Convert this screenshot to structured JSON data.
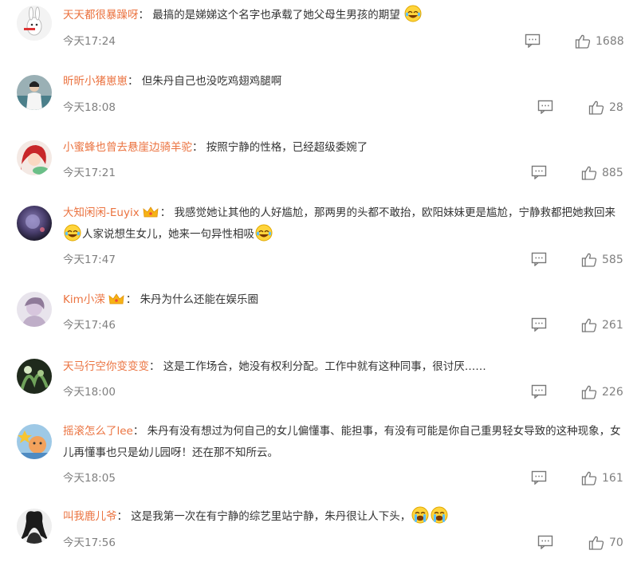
{
  "comments": [
    {
      "user": "天天都很暴躁呀",
      "sep": "：",
      "parts": [
        "最搞的是娣娣这个名字也承载了她父母生男孩的期望"
      ],
      "time": "今天17:24",
      "likes": "1688"
    },
    {
      "user": "昕昕小猪崽崽",
      "sep": "：",
      "parts": [
        "但朱丹自己也没吃鸡翅鸡腿啊"
      ],
      "time": "今天18:08",
      "likes": "28"
    },
    {
      "user": "小蜜蜂也曾去悬崖边骑羊驼",
      "sep": "：",
      "parts": [
        "按照宁静的性格，已经超级委婉了"
      ],
      "time": "今天17:21",
      "likes": "885"
    },
    {
      "user": "大知闲闲-Euyix",
      "sep": "：",
      "parts": [
        "我感觉她让其他的人好尴尬，那两男的头都不敢抬，欧阳妹妹更是尴尬，宁静救都把她救回来",
        "人家说想生女儿，她来一句异性相吸"
      ],
      "time": "今天17:47",
      "likes": "585"
    },
    {
      "user": "Kim小溁",
      "sep": "：",
      "parts": [
        "朱丹为什么还能在娱乐圈"
      ],
      "time": "今天17:46",
      "likes": "261"
    },
    {
      "user": "天马行空你变变变",
      "sep": "：",
      "parts": [
        "这是工作场合，她没有权利分配。工作中就有这种同事，很讨厌……"
      ],
      "time": "今天18:00",
      "likes": "226"
    },
    {
      "user": "摇滚怎么了lee",
      "sep": "：",
      "parts": [
        "朱丹有没有想过为何自己的女儿偏懂事、能担事，有没有可能是你自己重男轻女导致的这种现象，女儿再懂事也只是幼儿园呀！还在那不知所云。"
      ],
      "time": "今天18:05",
      "likes": "161"
    },
    {
      "user": "叫我鹿儿爷",
      "sep": "：",
      "parts": [
        "这是我第一次在有宁静的综艺里站宁静，朱丹很让人下头，"
      ],
      "time": "今天17:56",
      "likes": "70"
    }
  ],
  "icons": {
    "reply": "comment-icon",
    "like": "thumbs-up-icon",
    "crown": "crown-badge-icon",
    "laugh": "laugh-tears-emoji",
    "cry": "crying-emoji"
  },
  "colors": {
    "username": "#eb7340",
    "text": "#333333",
    "meta": "#808080"
  }
}
